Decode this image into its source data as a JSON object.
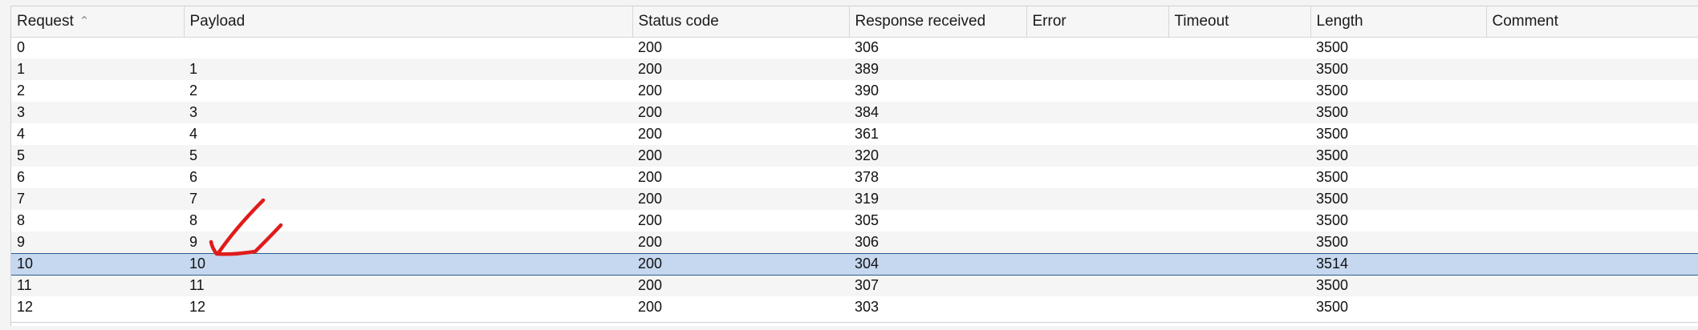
{
  "table": {
    "columns": [
      {
        "label": "Request",
        "sorted": "ascending"
      },
      {
        "label": "Payload"
      },
      {
        "label": "Status code"
      },
      {
        "label": "Response received"
      },
      {
        "label": "Error"
      },
      {
        "label": "Timeout"
      },
      {
        "label": "Length"
      },
      {
        "label": "Comment"
      }
    ],
    "sort_indicator": "^",
    "rows": [
      {
        "request": "0",
        "payload": "",
        "status": "200",
        "response": "306",
        "error": "",
        "timeout": "",
        "length": "3500",
        "comment": ""
      },
      {
        "request": "1",
        "payload": "1",
        "status": "200",
        "response": "389",
        "error": "",
        "timeout": "",
        "length": "3500",
        "comment": ""
      },
      {
        "request": "2",
        "payload": "2",
        "status": "200",
        "response": "390",
        "error": "",
        "timeout": "",
        "length": "3500",
        "comment": ""
      },
      {
        "request": "3",
        "payload": "3",
        "status": "200",
        "response": "384",
        "error": "",
        "timeout": "",
        "length": "3500",
        "comment": ""
      },
      {
        "request": "4",
        "payload": "4",
        "status": "200",
        "response": "361",
        "error": "",
        "timeout": "",
        "length": "3500",
        "comment": ""
      },
      {
        "request": "5",
        "payload": "5",
        "status": "200",
        "response": "320",
        "error": "",
        "timeout": "",
        "length": "3500",
        "comment": ""
      },
      {
        "request": "6",
        "payload": "6",
        "status": "200",
        "response": "378",
        "error": "",
        "timeout": "",
        "length": "3500",
        "comment": ""
      },
      {
        "request": "7",
        "payload": "7",
        "status": "200",
        "response": "319",
        "error": "",
        "timeout": "",
        "length": "3500",
        "comment": ""
      },
      {
        "request": "8",
        "payload": "8",
        "status": "200",
        "response": "305",
        "error": "",
        "timeout": "",
        "length": "3500",
        "comment": ""
      },
      {
        "request": "9",
        "payload": "9",
        "status": "200",
        "response": "306",
        "error": "",
        "timeout": "",
        "length": "3500",
        "comment": ""
      },
      {
        "request": "10",
        "payload": "10",
        "status": "200",
        "response": "304",
        "error": "",
        "timeout": "",
        "length": "3514",
        "comment": ""
      },
      {
        "request": "11",
        "payload": "11",
        "status": "200",
        "response": "307",
        "error": "",
        "timeout": "",
        "length": "3500",
        "comment": ""
      },
      {
        "request": "12",
        "payload": "12",
        "status": "200",
        "response": "303",
        "error": "",
        "timeout": "",
        "length": "3500",
        "comment": ""
      }
    ],
    "selected_row": 10
  },
  "colors": {
    "selected_row_bg": "#c6d8ef",
    "selected_row_border": "#2a5d8f",
    "annotation_arrow": "#e01b1b"
  },
  "annotation": {
    "shape": "hand-drawn-arrow",
    "points_to": "payload-10"
  }
}
